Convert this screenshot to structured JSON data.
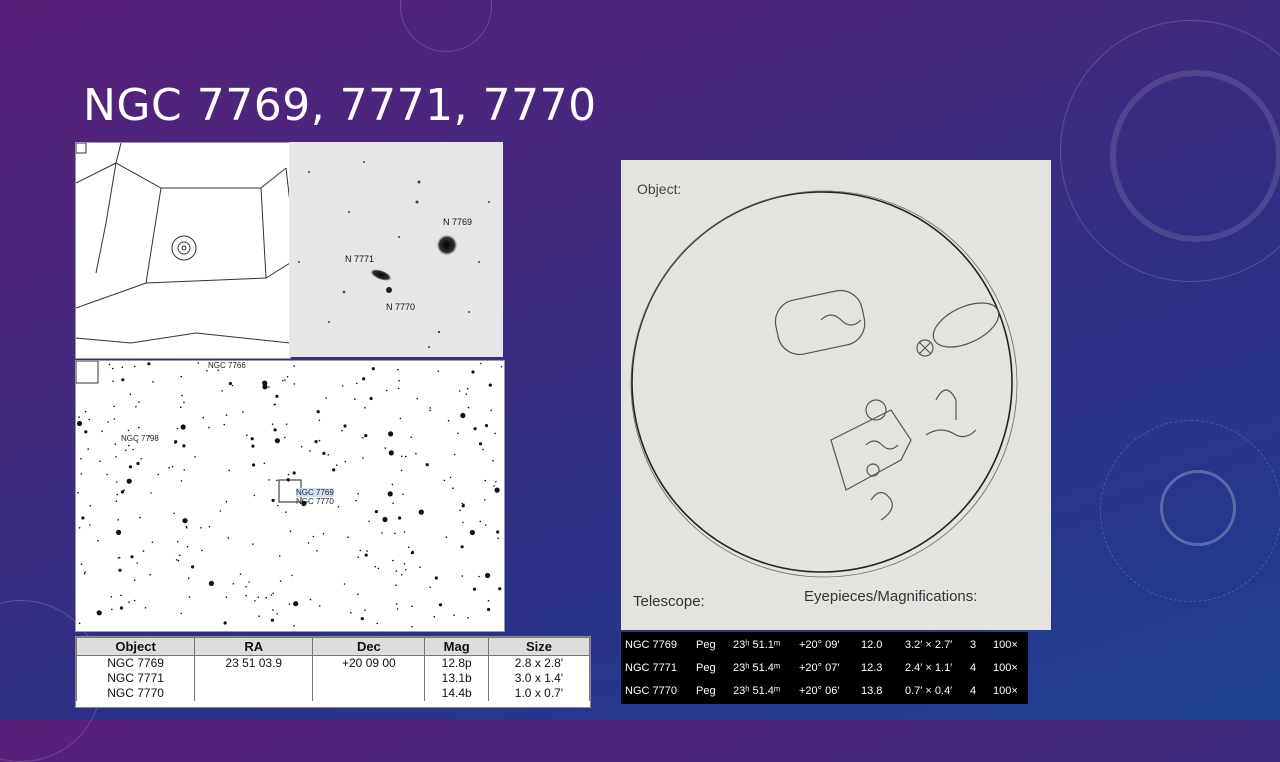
{
  "slide": {
    "title": "NGC 7769, 7771, 7770"
  },
  "photo": {
    "labels": [
      "N 7769",
      "N 7771",
      "N 7770"
    ]
  },
  "star_map": {
    "labels": [
      "NGC 7766",
      "NGC 7798",
      "NGC 7769",
      "NGC 7770"
    ]
  },
  "catalog_table": {
    "headers": [
      "Object",
      "RA",
      "Dec",
      "Mag",
      "Size"
    ],
    "rows": [
      [
        "NGC 7769",
        "23 51 03.9",
        "+20 09 00",
        "12.8p",
        "2.8 x 2.8'"
      ],
      [
        "NGC 7771",
        "",
        "",
        "13.1b",
        "3.0 x 1.4'"
      ],
      [
        "NGC 7770",
        "",
        "",
        "14.4b",
        "1.0 x 0.7'"
      ]
    ]
  },
  "sketch": {
    "object_label": "Object:",
    "telescope_label": "Telescope:",
    "eyepieces_label": "Eyepieces/Magnifications:"
  },
  "data_strip": {
    "rows": [
      [
        "NGC 7769",
        "Peg",
        "23ʰ 51.1ᵐ",
        "+20° 09′",
        "12.0",
        "3.2′ × 2.7′",
        "3",
        "100×"
      ],
      [
        "NGC 7771",
        "Peg",
        "23ʰ 51.4ᵐ",
        "+20° 07′",
        "12.3",
        "2.4′ × 1.1′",
        "4",
        "100×"
      ],
      [
        "NGC 7770",
        "Peg",
        "23ʰ 51.4ᵐ",
        "+20° 06′",
        "13.8",
        "0.7′ × 0.4′",
        "4",
        "100×"
      ]
    ]
  }
}
